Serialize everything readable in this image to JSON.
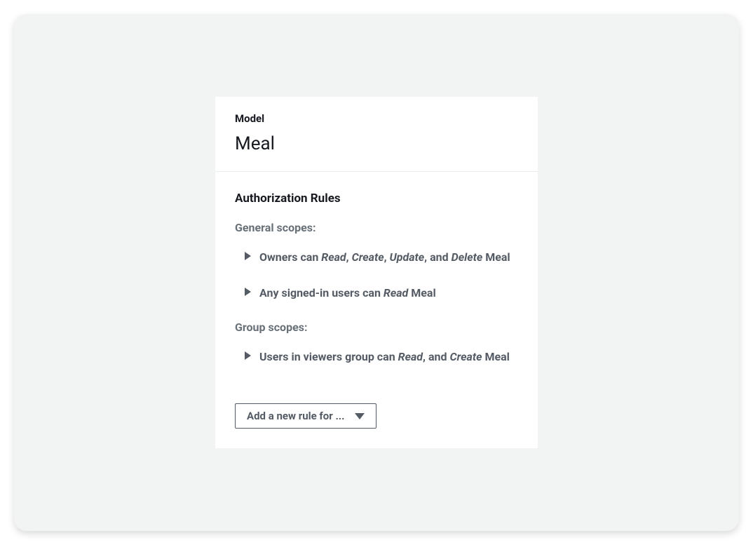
{
  "header": {
    "label": "Model",
    "name": "Meal"
  },
  "auth": {
    "title": "Authorization Rules",
    "general_scopes_label": "General scopes:",
    "group_scopes_label": "Group scopes:",
    "rules": {
      "owners": {
        "subject": "Owners",
        "actions": [
          "Read",
          "Create",
          "Update",
          "Delete"
        ],
        "target": "Meal"
      },
      "signed_in": {
        "subject": "Any signed-in users",
        "actions": [
          "Read"
        ],
        "target": "Meal"
      },
      "viewers_group": {
        "subject": "Users in viewers group",
        "actions": [
          "Read",
          "Create"
        ],
        "target": "Meal"
      }
    },
    "add_rule_label": "Add a new rule for ..."
  }
}
